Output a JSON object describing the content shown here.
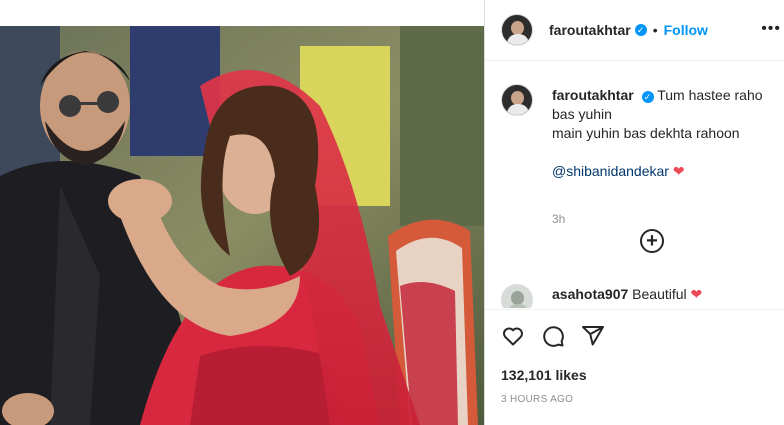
{
  "post": {
    "photo_alt": "Farhan Akhtar and Shibani Dandekar wedding photo",
    "header": {
      "username": "faroutakhtar",
      "verified_mark": "✓",
      "separator": "•",
      "follow_label": "Follow",
      "more_label": "•••"
    },
    "caption": {
      "username": "faroutakhtar",
      "verified_mark": "✓",
      "line1": "Tum hastee raho bas yuhin",
      "line2": "main yuhin bas dekhta rahoon",
      "mention": "@shibanidandekar",
      "heart": "❤",
      "time": "3h"
    },
    "load_more_label": "+",
    "comments": [
      {
        "username": "asahota907",
        "text": "Beautiful",
        "heart": "❤"
      }
    ],
    "likes_text": "132,101 likes",
    "time_text": "3 HOURS AGO",
    "icons": [
      "heart-icon",
      "comment-icon",
      "share-icon"
    ]
  },
  "colors": {
    "accent": "#0095f6",
    "heart": "#ed4956",
    "mention": "#00376b",
    "muted": "#8e8e8e",
    "text": "#262626"
  }
}
